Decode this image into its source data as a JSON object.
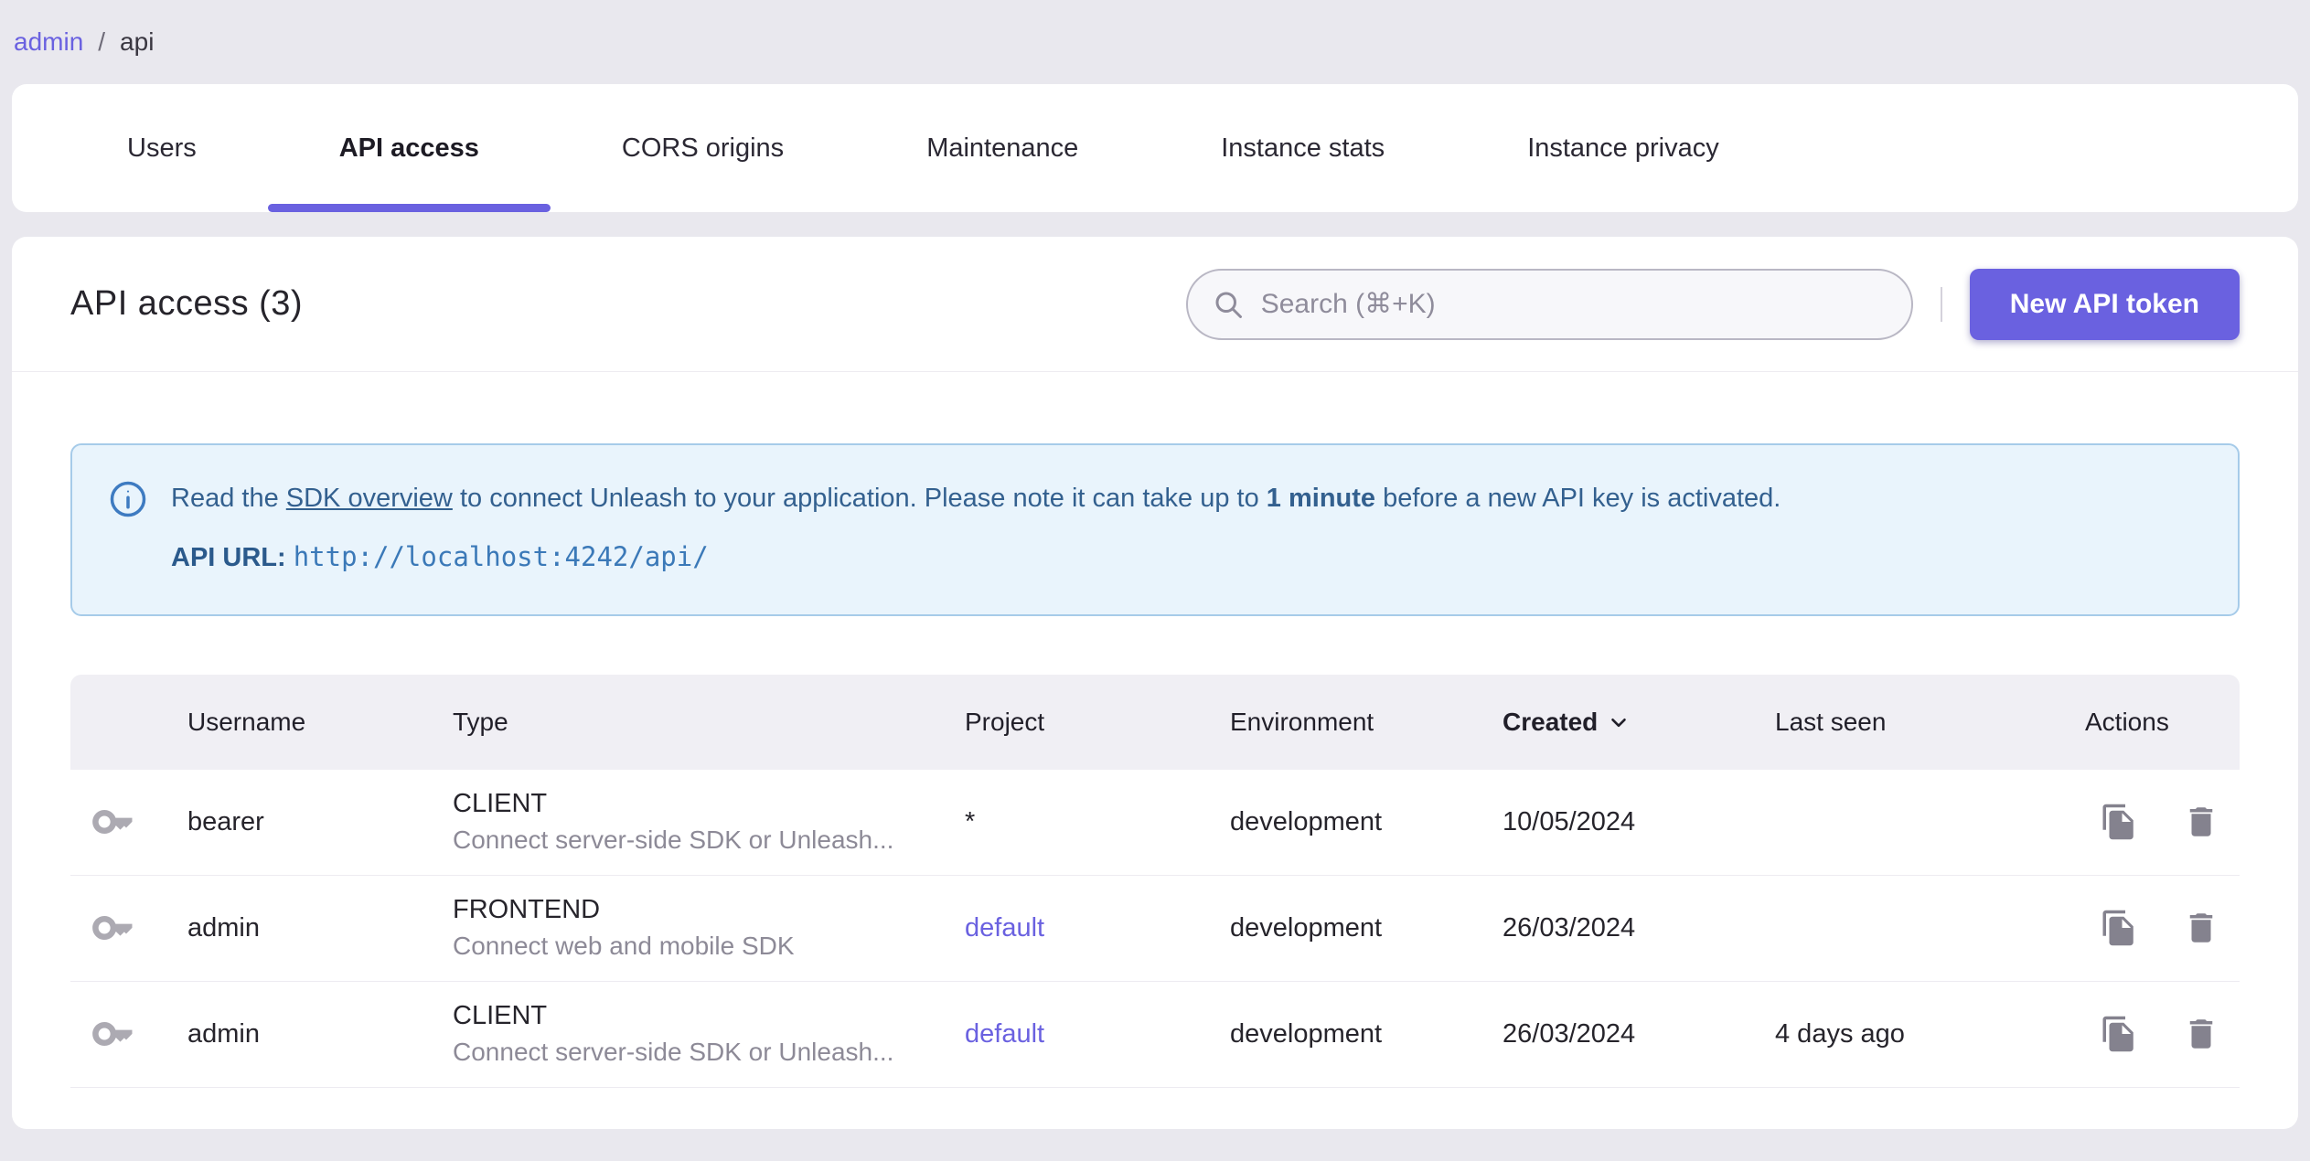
{
  "breadcrumb": {
    "link": "admin",
    "separator": "/",
    "current": "api"
  },
  "tabs": {
    "items": [
      {
        "label": "Users",
        "active": false
      },
      {
        "label": "API access",
        "active": true
      },
      {
        "label": "CORS origins",
        "active": false
      },
      {
        "label": "Maintenance",
        "active": false
      },
      {
        "label": "Instance stats",
        "active": false
      },
      {
        "label": "Instance privacy",
        "active": false
      }
    ]
  },
  "toolbar": {
    "title": "API access (3)",
    "search_placeholder": "Search (⌘+K)",
    "new_token_button": "New API token"
  },
  "info_box": {
    "text_before_link": "Read the ",
    "link": "SDK overview",
    "text_middle": " to connect Unleash to your application. Please note it can take up to ",
    "bold": "1 minute",
    "text_after": " before a new API key is activated.",
    "api_url_label": "API URL",
    "api_url_separator": ": ",
    "api_url": "http://localhost:4242/api/"
  },
  "table": {
    "columns": [
      "Username",
      "Type",
      "Project",
      "Environment",
      "Created",
      "Last seen",
      "Actions"
    ],
    "sorted_column": "Created",
    "sort_direction": "desc",
    "rows": [
      {
        "username": "bearer",
        "type": "CLIENT",
        "type_description": "Connect server-side SDK or Unleash...",
        "project": "*",
        "environment": "development",
        "created": "10/05/2024",
        "last_seen": ""
      },
      {
        "username": "admin",
        "type": "FRONTEND",
        "type_description": "Connect web and mobile SDK",
        "project": "default",
        "environment": "development",
        "created": "26/03/2024",
        "last_seen": ""
      },
      {
        "username": "admin",
        "type": "CLIENT",
        "type_description": "Connect server-side SDK or Unleash...",
        "project": "default",
        "environment": "development",
        "created": "26/03/2024",
        "last_seen": "4 days ago"
      }
    ]
  },
  "colors": {
    "accent": "#6A61E0",
    "page_background": "#E9E8EE",
    "info_background": "#E9F4FC",
    "info_border": "#A6CBE9",
    "info_text": "#33608F",
    "table_header_background": "#F0EFF4"
  }
}
